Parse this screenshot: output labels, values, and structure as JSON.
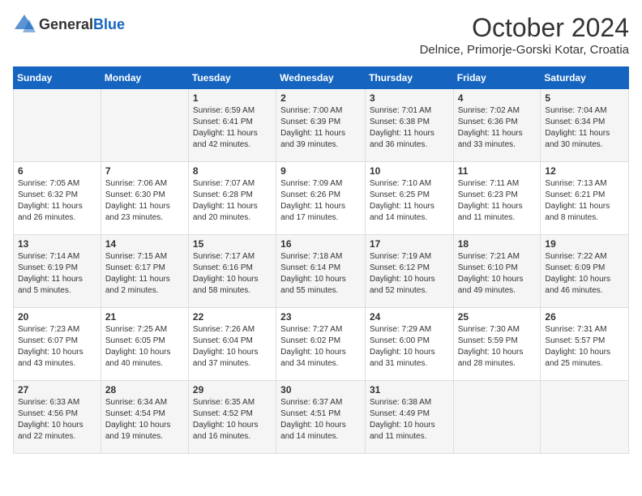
{
  "logo": {
    "text_general": "General",
    "text_blue": "Blue"
  },
  "header": {
    "month": "October 2024",
    "location": "Delnice, Primorje-Gorski Kotar, Croatia"
  },
  "days_of_week": [
    "Sunday",
    "Monday",
    "Tuesday",
    "Wednesday",
    "Thursday",
    "Friday",
    "Saturday"
  ],
  "weeks": [
    [
      {
        "day": "",
        "sunrise": "",
        "sunset": "",
        "daylight": ""
      },
      {
        "day": "",
        "sunrise": "",
        "sunset": "",
        "daylight": ""
      },
      {
        "day": "1",
        "sunrise": "Sunrise: 6:59 AM",
        "sunset": "Sunset: 6:41 PM",
        "daylight": "Daylight: 11 hours and 42 minutes."
      },
      {
        "day": "2",
        "sunrise": "Sunrise: 7:00 AM",
        "sunset": "Sunset: 6:39 PM",
        "daylight": "Daylight: 11 hours and 39 minutes."
      },
      {
        "day": "3",
        "sunrise": "Sunrise: 7:01 AM",
        "sunset": "Sunset: 6:38 PM",
        "daylight": "Daylight: 11 hours and 36 minutes."
      },
      {
        "day": "4",
        "sunrise": "Sunrise: 7:02 AM",
        "sunset": "Sunset: 6:36 PM",
        "daylight": "Daylight: 11 hours and 33 minutes."
      },
      {
        "day": "5",
        "sunrise": "Sunrise: 7:04 AM",
        "sunset": "Sunset: 6:34 PM",
        "daylight": "Daylight: 11 hours and 30 minutes."
      }
    ],
    [
      {
        "day": "6",
        "sunrise": "Sunrise: 7:05 AM",
        "sunset": "Sunset: 6:32 PM",
        "daylight": "Daylight: 11 hours and 26 minutes."
      },
      {
        "day": "7",
        "sunrise": "Sunrise: 7:06 AM",
        "sunset": "Sunset: 6:30 PM",
        "daylight": "Daylight: 11 hours and 23 minutes."
      },
      {
        "day": "8",
        "sunrise": "Sunrise: 7:07 AM",
        "sunset": "Sunset: 6:28 PM",
        "daylight": "Daylight: 11 hours and 20 minutes."
      },
      {
        "day": "9",
        "sunrise": "Sunrise: 7:09 AM",
        "sunset": "Sunset: 6:26 PM",
        "daylight": "Daylight: 11 hours and 17 minutes."
      },
      {
        "day": "10",
        "sunrise": "Sunrise: 7:10 AM",
        "sunset": "Sunset: 6:25 PM",
        "daylight": "Daylight: 11 hours and 14 minutes."
      },
      {
        "day": "11",
        "sunrise": "Sunrise: 7:11 AM",
        "sunset": "Sunset: 6:23 PM",
        "daylight": "Daylight: 11 hours and 11 minutes."
      },
      {
        "day": "12",
        "sunrise": "Sunrise: 7:13 AM",
        "sunset": "Sunset: 6:21 PM",
        "daylight": "Daylight: 11 hours and 8 minutes."
      }
    ],
    [
      {
        "day": "13",
        "sunrise": "Sunrise: 7:14 AM",
        "sunset": "Sunset: 6:19 PM",
        "daylight": "Daylight: 11 hours and 5 minutes."
      },
      {
        "day": "14",
        "sunrise": "Sunrise: 7:15 AM",
        "sunset": "Sunset: 6:17 PM",
        "daylight": "Daylight: 11 hours and 2 minutes."
      },
      {
        "day": "15",
        "sunrise": "Sunrise: 7:17 AM",
        "sunset": "Sunset: 6:16 PM",
        "daylight": "Daylight: 10 hours and 58 minutes."
      },
      {
        "day": "16",
        "sunrise": "Sunrise: 7:18 AM",
        "sunset": "Sunset: 6:14 PM",
        "daylight": "Daylight: 10 hours and 55 minutes."
      },
      {
        "day": "17",
        "sunrise": "Sunrise: 7:19 AM",
        "sunset": "Sunset: 6:12 PM",
        "daylight": "Daylight: 10 hours and 52 minutes."
      },
      {
        "day": "18",
        "sunrise": "Sunrise: 7:21 AM",
        "sunset": "Sunset: 6:10 PM",
        "daylight": "Daylight: 10 hours and 49 minutes."
      },
      {
        "day": "19",
        "sunrise": "Sunrise: 7:22 AM",
        "sunset": "Sunset: 6:09 PM",
        "daylight": "Daylight: 10 hours and 46 minutes."
      }
    ],
    [
      {
        "day": "20",
        "sunrise": "Sunrise: 7:23 AM",
        "sunset": "Sunset: 6:07 PM",
        "daylight": "Daylight: 10 hours and 43 minutes."
      },
      {
        "day": "21",
        "sunrise": "Sunrise: 7:25 AM",
        "sunset": "Sunset: 6:05 PM",
        "daylight": "Daylight: 10 hours and 40 minutes."
      },
      {
        "day": "22",
        "sunrise": "Sunrise: 7:26 AM",
        "sunset": "Sunset: 6:04 PM",
        "daylight": "Daylight: 10 hours and 37 minutes."
      },
      {
        "day": "23",
        "sunrise": "Sunrise: 7:27 AM",
        "sunset": "Sunset: 6:02 PM",
        "daylight": "Daylight: 10 hours and 34 minutes."
      },
      {
        "day": "24",
        "sunrise": "Sunrise: 7:29 AM",
        "sunset": "Sunset: 6:00 PM",
        "daylight": "Daylight: 10 hours and 31 minutes."
      },
      {
        "day": "25",
        "sunrise": "Sunrise: 7:30 AM",
        "sunset": "Sunset: 5:59 PM",
        "daylight": "Daylight: 10 hours and 28 minutes."
      },
      {
        "day": "26",
        "sunrise": "Sunrise: 7:31 AM",
        "sunset": "Sunset: 5:57 PM",
        "daylight": "Daylight: 10 hours and 25 minutes."
      }
    ],
    [
      {
        "day": "27",
        "sunrise": "Sunrise: 6:33 AM",
        "sunset": "Sunset: 4:56 PM",
        "daylight": "Daylight: 10 hours and 22 minutes."
      },
      {
        "day": "28",
        "sunrise": "Sunrise: 6:34 AM",
        "sunset": "Sunset: 4:54 PM",
        "daylight": "Daylight: 10 hours and 19 minutes."
      },
      {
        "day": "29",
        "sunrise": "Sunrise: 6:35 AM",
        "sunset": "Sunset: 4:52 PM",
        "daylight": "Daylight: 10 hours and 16 minutes."
      },
      {
        "day": "30",
        "sunrise": "Sunrise: 6:37 AM",
        "sunset": "Sunset: 4:51 PM",
        "daylight": "Daylight: 10 hours and 14 minutes."
      },
      {
        "day": "31",
        "sunrise": "Sunrise: 6:38 AM",
        "sunset": "Sunset: 4:49 PM",
        "daylight": "Daylight: 10 hours and 11 minutes."
      },
      {
        "day": "",
        "sunrise": "",
        "sunset": "",
        "daylight": ""
      },
      {
        "day": "",
        "sunrise": "",
        "sunset": "",
        "daylight": ""
      }
    ]
  ]
}
